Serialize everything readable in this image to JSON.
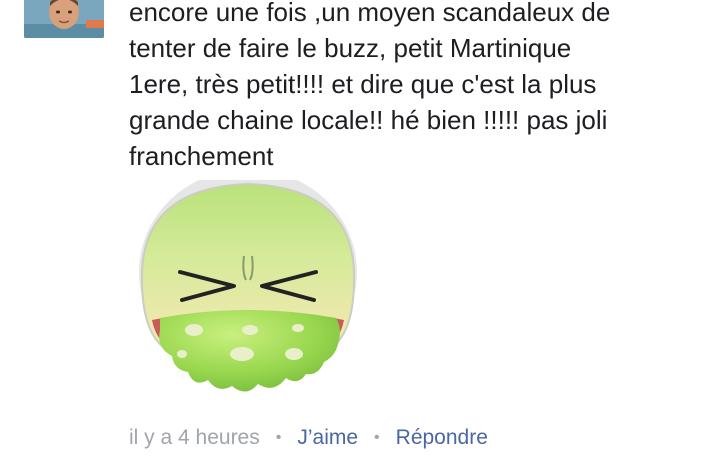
{
  "comment": {
    "avatar_icon": "user-avatar-photo",
    "text": "encore une fois ,un moyen scandaleux de\ntenter de faire le buzz, petit Martinique\n1ere, très petit!!!! et dire que c'est la plus\ngrande chaine locale!! hé bien !!!!! pas joli\nfranchement",
    "sticker_icon": "vomiting-face-sticker",
    "timestamp": "il y a 4 heures",
    "separator": "•",
    "like_label": "J’aime",
    "reply_label": "Répondre"
  },
  "colors": {
    "text": "#1c1e21",
    "meta": "#a0a4ab",
    "link": "#4b67a1"
  }
}
